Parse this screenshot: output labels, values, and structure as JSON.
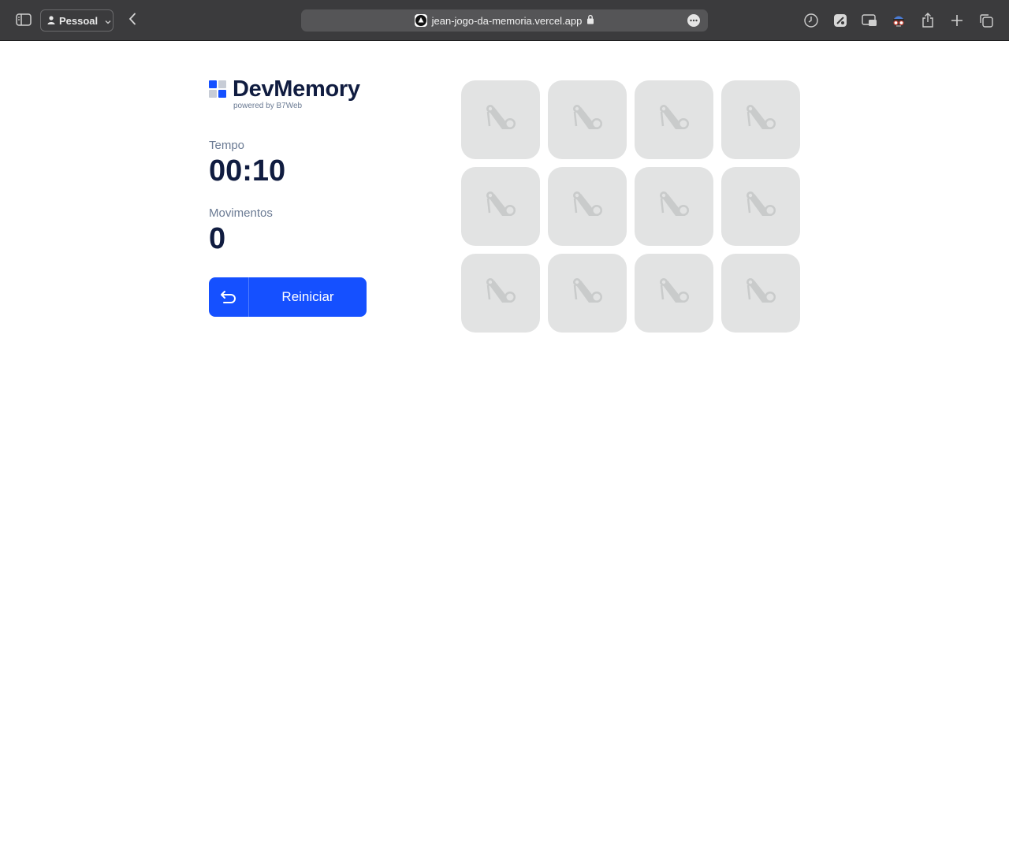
{
  "browser": {
    "profile_label": "Pessoal",
    "url": "jean-jogo-da-memoria.vercel.app",
    "icons": {
      "sidebar": "sidebar-icon",
      "profile": "person-icon",
      "back": "chevron-left-icon",
      "site": "vercel-triangle-icon",
      "lock": "lock-icon",
      "more": "ellipsis-icon",
      "history": "clock-icon",
      "extension": "extension-icon",
      "pip": "picture-in-picture-icon",
      "spy": "spy-extension-icon",
      "share": "share-icon",
      "new_tab": "plus-icon",
      "tabs": "tabs-overview-icon"
    }
  },
  "app": {
    "logo": {
      "title": "DevMemory",
      "subtitle": "powered by B7Web"
    },
    "stats": {
      "time_label": "Tempo",
      "time_value": "00:10",
      "moves_label": "Movimentos",
      "moves_value": "0"
    },
    "restart_button": {
      "label": "Reiniciar",
      "icon": "restart-arrow-icon"
    },
    "cards": [
      {
        "state": "hidden"
      },
      {
        "state": "hidden"
      },
      {
        "state": "hidden"
      },
      {
        "state": "hidden"
      },
      {
        "state": "hidden"
      },
      {
        "state": "hidden"
      },
      {
        "state": "hidden"
      },
      {
        "state": "hidden"
      },
      {
        "state": "hidden"
      },
      {
        "state": "hidden"
      },
      {
        "state": "hidden"
      },
      {
        "state": "hidden"
      }
    ],
    "card_icon": "card-back-icon"
  },
  "colors": {
    "accent": "#1550ff",
    "text_dark": "#101c40",
    "text_muted": "#6a7a93",
    "card_bg": "#e2e3e3",
    "chrome_bg": "#3b3b3d"
  }
}
